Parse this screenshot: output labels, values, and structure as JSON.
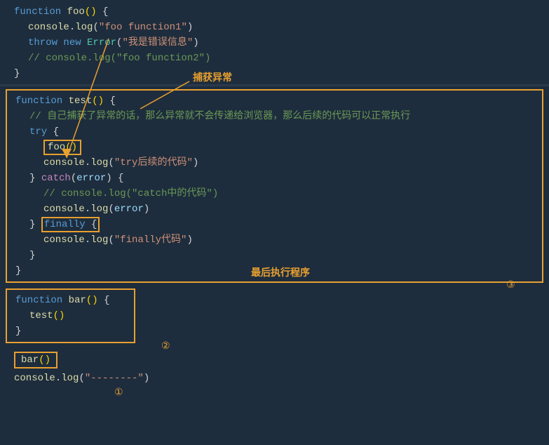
{
  "colors": {
    "bg": "#1a2332",
    "editor_bg": "#1e2d3d",
    "orange": "#e8a030",
    "keyword_blue": "#569cd6",
    "fn_yellow": "#dcdcaa",
    "string_orange": "#ce9178",
    "comment_green": "#6a9955",
    "teal": "#4ec9b0",
    "purple": "#c586c0",
    "white": "#d4d4d4",
    "var_blue": "#9cdcfe"
  },
  "annotations": {
    "capture_exception": "捕获异常",
    "last_execute": "最后执行程序",
    "circle1": "①",
    "circle2": "②",
    "circle3": "③"
  },
  "code": {
    "foo_func": [
      "function foo() {",
      "  console.log(\"foo function1\")",
      "  throw new Error(\"我是错误信息\")",
      "  // console.log(\"foo function2\")",
      "}"
    ],
    "test_func": [
      "function test() {",
      "  // 自己捕获了异常的话，那么异常就不会传递给浏览器，那么后续的代码可以正常执行",
      "  try {",
      "    foo()",
      "    console.log(\"try后续的代码\")",
      "  } catch(error) {",
      "    // console.log(\"catch中的代码\")",
      "    console.log(error)",
      "  } finally {",
      "    console.log(\"finally代码\")",
      "  }",
      "}"
    ],
    "bar_func": [
      "function bar() {",
      "  test()",
      "}"
    ],
    "call_bar": "bar()",
    "last_line": "console.log(\"--------\")"
  }
}
